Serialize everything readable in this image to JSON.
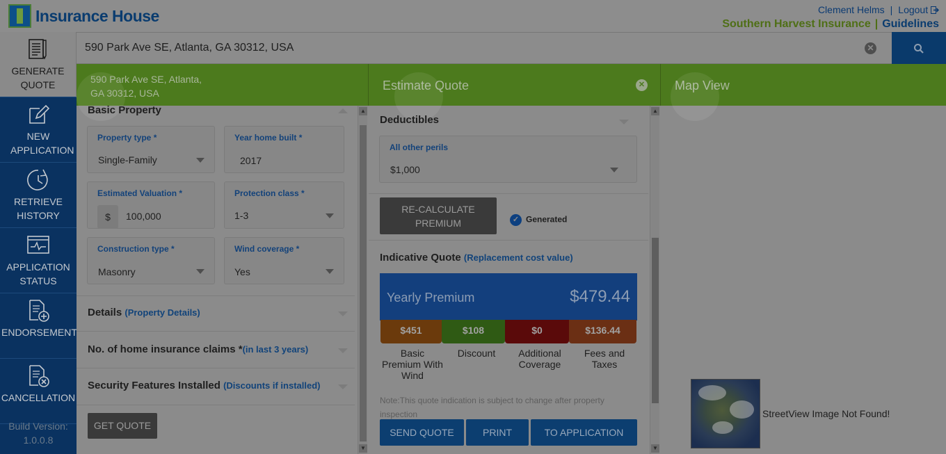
{
  "header": {
    "logo_text": "Insurance House",
    "user_name": "Clement Helms",
    "logout": "Logout",
    "company": "Southern Harvest Insurance",
    "guidelines": "Guidelines"
  },
  "sidebar": {
    "items": [
      {
        "label": "GENERATE QUOTE",
        "icon": "document-pen-icon"
      },
      {
        "label": "NEW APPLICATION",
        "icon": "edit-icon"
      },
      {
        "label": "RETRIEVE HISTORY",
        "icon": "history-icon"
      },
      {
        "label": "APPLICATION STATUS",
        "icon": "status-monitor-icon"
      },
      {
        "label": "ENDORSEMENT",
        "icon": "document-plus-icon"
      },
      {
        "label": "CANCELLATION",
        "icon": "document-cancel-icon"
      }
    ],
    "build_label": "Build Version:",
    "build_version": "1.0.0.8"
  },
  "search": {
    "value": "590 Park Ave SE, Atlanta, GA 30312, USA"
  },
  "panel1": {
    "header_address": "590 Park Ave SE, Atlanta, GA 30312, USA",
    "basic_property": "Basic Property",
    "property_type_label": "Property type *",
    "property_type_value": "Single-Family",
    "year_built_label": "Year home built *",
    "year_built_value": "2017",
    "valuation_label": "Estimated Valuation *",
    "valuation_currency": "$",
    "valuation_value": "100,000",
    "protection_label": "Protection class *",
    "protection_value": "1-3",
    "construction_label": "Construction type *",
    "construction_value": "Masonry",
    "wind_label": "Wind coverage *",
    "wind_value": "Yes",
    "details_title": "Details",
    "details_sub": "(Property Details)",
    "claims_title": "No. of home insurance claims *",
    "claims_sub": "(in last 3 years)",
    "security_title": "Security Features Installed",
    "security_sub": "(Discounts if installed)",
    "get_quote": "GET QUOTE"
  },
  "panel2": {
    "title": "Estimate Quote",
    "deductibles": "Deductibles",
    "perils_label": "All other perils",
    "perils_value": "$1,000",
    "recalc_line1": "RE-CALCULATE",
    "recalc_line2": "PREMIUM",
    "generated": "Generated",
    "indicative": "Indicative Quote",
    "indicative_sub": "(Replacement cost value)",
    "yearly_label": "Yearly Premium",
    "yearly_amount": "$479.44",
    "breakdown": [
      {
        "amount": "$451",
        "label_lines": [
          "Basic",
          "Premium With",
          "Wind"
        ],
        "color": "#6b3a0c"
      },
      {
        "amount": "$108",
        "label_lines": [
          "Discount"
        ],
        "color": "#2f5a14"
      },
      {
        "amount": "$0",
        "label_lines": [
          "Additional",
          "Coverage"
        ],
        "color": "#5a0a0a"
      },
      {
        "amount": "$136.44",
        "label_lines": [
          "Fees and",
          "Taxes"
        ],
        "color": "#6b2f14"
      }
    ],
    "note_line1": "Note:This quote indication is subject to change after property",
    "note_line2": "inspection",
    "send_quote": "SEND QUOTE",
    "print": "PRINT",
    "to_application": "TO APPLICATION"
  },
  "panel3": {
    "title": "Map View",
    "streetview": "StreetView Image Not Found!"
  }
}
